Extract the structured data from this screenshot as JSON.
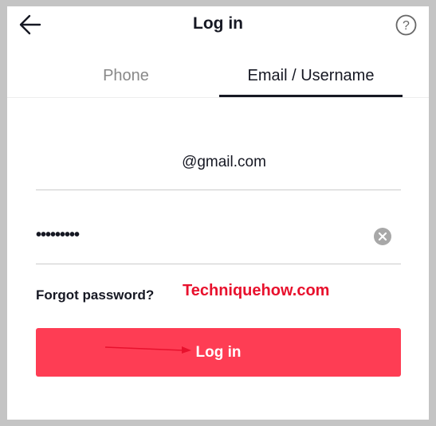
{
  "header": {
    "title": "Log in",
    "back_icon": "arrow-left-icon",
    "help_icon": "question-circle-icon"
  },
  "tabs": [
    {
      "label": "Phone",
      "active": false
    },
    {
      "label": "Email / Username",
      "active": true
    }
  ],
  "form": {
    "email_value": "@gmail.com",
    "password_value": "•••••••••",
    "clear_icon": "clear-circle-icon",
    "forgot_label": "Forgot password?",
    "login_label": "Log in"
  },
  "watermark": "Techniquehow.com",
  "colors": {
    "accent": "#fe3d54",
    "watermark": "#e8112d"
  }
}
